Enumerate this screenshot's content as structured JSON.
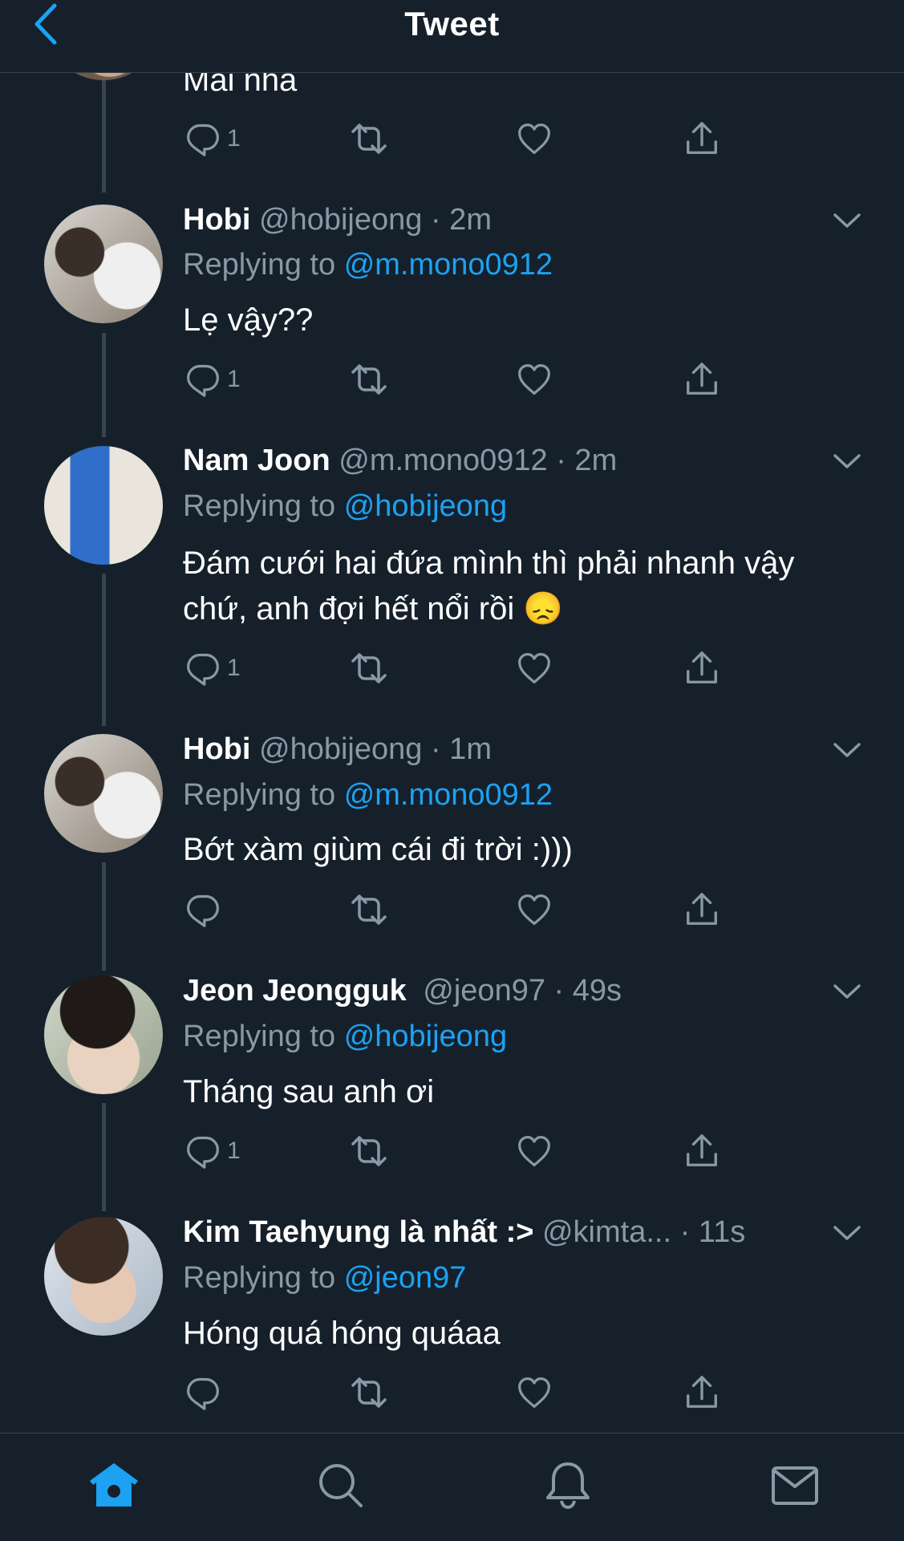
{
  "header": {
    "title": "Tweet"
  },
  "colors": {
    "background": "#15202b",
    "accent": "#1da1f2",
    "muted": "#8899a6",
    "divider": "#38444d"
  },
  "partial_tweet": {
    "text": "Mai nha",
    "reply_count": "1"
  },
  "tweets": [
    {
      "name": "Hobi",
      "handle": "@hobijeong",
      "time": "· 2m",
      "replying_label": "Replying to",
      "replying_to": "@m.mono0912",
      "text": "Lẹ vậy??",
      "reply_count": "1"
    },
    {
      "name": "Nam Joon",
      "handle": "@m.mono0912",
      "time": "· 2m",
      "replying_label": "Replying to",
      "replying_to": "@hobijeong",
      "text_line1": "Đám cưới hai đứa mình thì phải nhanh vậy",
      "text_line2": "chứ, anh đợi hết nổi rồi",
      "emoji": "😞",
      "reply_count": "1"
    },
    {
      "name": "Hobi",
      "handle": "@hobijeong",
      "time": "· 1m",
      "replying_label": "Replying to",
      "replying_to": "@m.mono0912",
      "text": "Bớt xàm giùm cái đi trời :)))",
      "reply_count": ""
    },
    {
      "name": "Jeon Jeongguk",
      "handle": "@jeon97",
      "time": "· 49s",
      "replying_label": "Replying to",
      "replying_to": "@hobijeong",
      "text": "Tháng sau anh ơi",
      "reply_count": "1"
    },
    {
      "name": "Kim Taehyung là nhất :>",
      "handle": "@kimta...",
      "time": "· 11s",
      "replying_label": "Replying to",
      "replying_to": "@jeon97",
      "text": "Hóng quá hóng quáaa",
      "reply_count": ""
    }
  ],
  "icons": {
    "back": "chevron-left-icon",
    "reply": "reply-icon",
    "retweet": "retweet-icon",
    "like": "heart-icon",
    "share": "share-icon",
    "more": "chevron-down-icon",
    "home": "home-icon",
    "search": "search-icon",
    "notifications": "bell-icon",
    "messages": "mail-icon"
  },
  "bottom_nav": {
    "active": "home"
  }
}
